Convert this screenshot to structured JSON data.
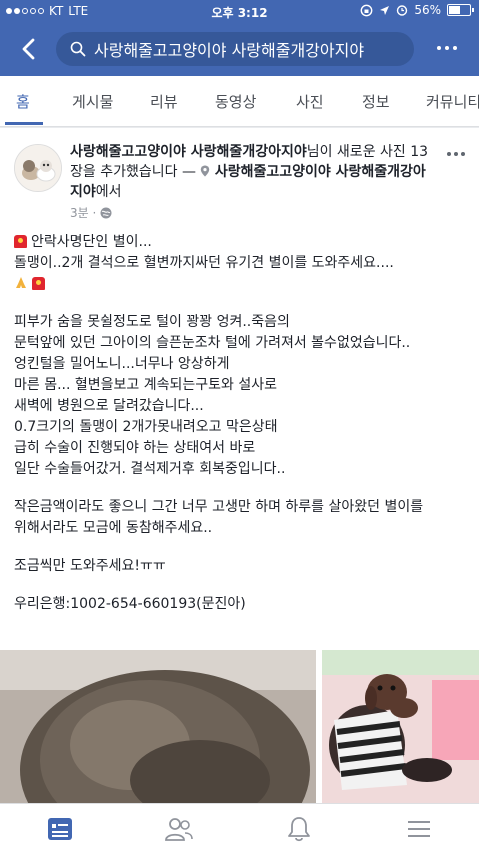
{
  "status_bar": {
    "carrier": "KT",
    "network": "LTE",
    "time": "오후 3:12",
    "battery": "56%",
    "battery_level": 0.56
  },
  "header": {
    "search_text": "사랑해줄고고양이야 사랑해줄개강아지야"
  },
  "tabs": [
    {
      "label": "홈",
      "active": true
    },
    {
      "label": "게시물"
    },
    {
      "label": "리뷰"
    },
    {
      "label": "동영상"
    },
    {
      "label": "사진"
    },
    {
      "label": "정보"
    },
    {
      "label": "커뮤니티"
    }
  ],
  "post": {
    "author": "사랑해줄고고양이야 사랑해줄개강아지야",
    "action": "님이 새로운 사진 13장을 추가했습니다 —",
    "location": "사랑해줄고고양이야 사랑해줄개강아지야",
    "location_suffix": "에서",
    "time": "3분 ·",
    "lines": [
      "안락사명단인 별이...",
      "돌맹이..2개 결석으로 혈변까지싸던 유기견 별이를 도와주세요....",
      "",
      "피부가 숨을 못쉴정도로 털이 꽝꽝 엉켜..죽음의",
      "문턱앞에 있던 그아이의 슬픈눈조차 털에 가려져서  볼수없었습니다..",
      "엉킨털을 밀어노니...너무나 앙상하게",
      "마른 몸... 혈변을보고 계속되는구토와 설사로",
      "새벽에 병원으로 달려갔습니다...",
      "0.7크기의 돌맹이 2개가못내려오고 막은상태",
      "급히 수술이 진행되야 하는 상태여서 바로",
      "일단 수술들어갔거. 결석제거후 회복중입니다..",
      "작은금액이라도 좋으니 그간 너무 고생만 하며 하루를 살아왔던 별이를",
      "위해서라도 모금에 동참해주세요..",
      "조금씩만 도와주세요!ㅠㅠ",
      "우리은행:1002-654-660193(문진아)"
    ]
  },
  "colors": {
    "brand_blue": "#4267b2",
    "search_bg": "#365899"
  }
}
